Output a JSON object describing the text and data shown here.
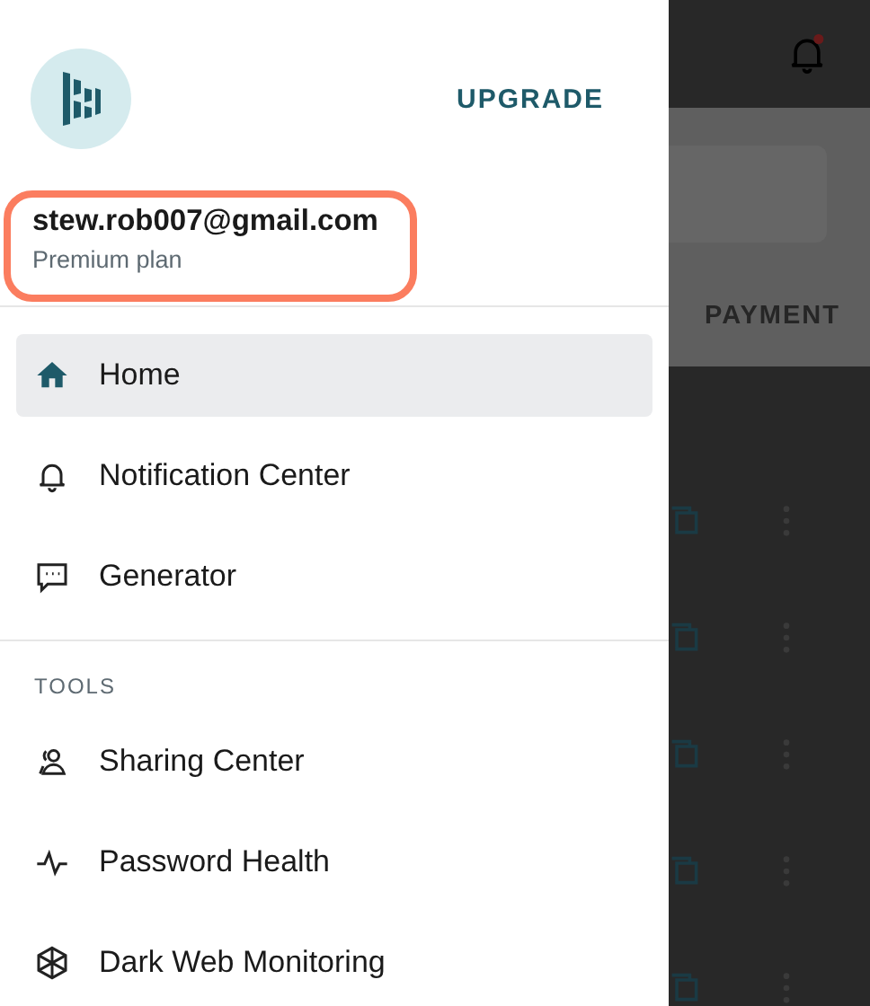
{
  "drawer": {
    "upgrade_button": "UPGRADE",
    "account": {
      "email": "stew.rob007@gmail.com",
      "plan": "Premium plan"
    },
    "main_items": [
      {
        "label": "Home",
        "selected": true
      },
      {
        "label": "Notification Center",
        "selected": false
      },
      {
        "label": "Generator",
        "selected": false
      }
    ],
    "tools": {
      "heading": "TOOLS",
      "items": [
        {
          "label": "Sharing Center",
          "selected": false
        },
        {
          "label": "Password Health",
          "selected": false
        },
        {
          "label": "Dark Web Monitoring",
          "selected": false
        }
      ]
    }
  },
  "background": {
    "tab": "PAYMENT"
  }
}
